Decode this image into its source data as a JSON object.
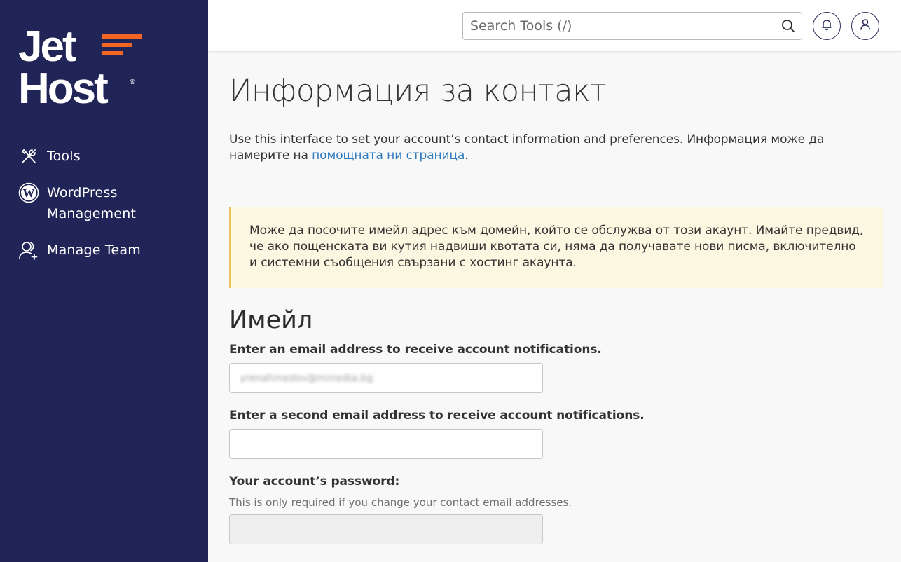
{
  "brand": {
    "line1": "Jet",
    "line2": "Host",
    "reg": "®",
    "accent": "#f26522",
    "sidebar_bg": "#212456"
  },
  "nav": [
    {
      "label": "Tools",
      "icon": "tools-icon"
    },
    {
      "label": "WordPress\nManagement",
      "icon": "wordpress-icon"
    },
    {
      "label": "Manage Team",
      "icon": "manage-team-icon"
    }
  ],
  "topbar": {
    "search_placeholder": "Search Tools (/)",
    "icons": [
      "search-icon",
      "bell-icon",
      "user-icon"
    ]
  },
  "page": {
    "title": "Информация за контакт",
    "intro_text": "Use this interface to set your account’s contact information and preferences. Информация може да намерите на ",
    "intro_link": "помощната ни страница",
    "intro_end": ".",
    "alert": "Може да посочите имейл адрес към домейн, който се обслужва от този акаунт. Имайте предвид, че ако пощенската ви кутия надвиши квотата си, няма да получавате нови писма, включително и системни съобщения свързани с хостинг акаунта."
  },
  "email_section": {
    "title": "Имейл",
    "email1_label": "Enter an email address to receive account notifications.",
    "email1_value": "yrenahmedov@mmedia.bg",
    "email2_label": "Enter a second email address to receive account notifications.",
    "email2_value": "",
    "password_label": "Your account’s password:",
    "password_help": "This is only required if you change your contact email addresses."
  }
}
